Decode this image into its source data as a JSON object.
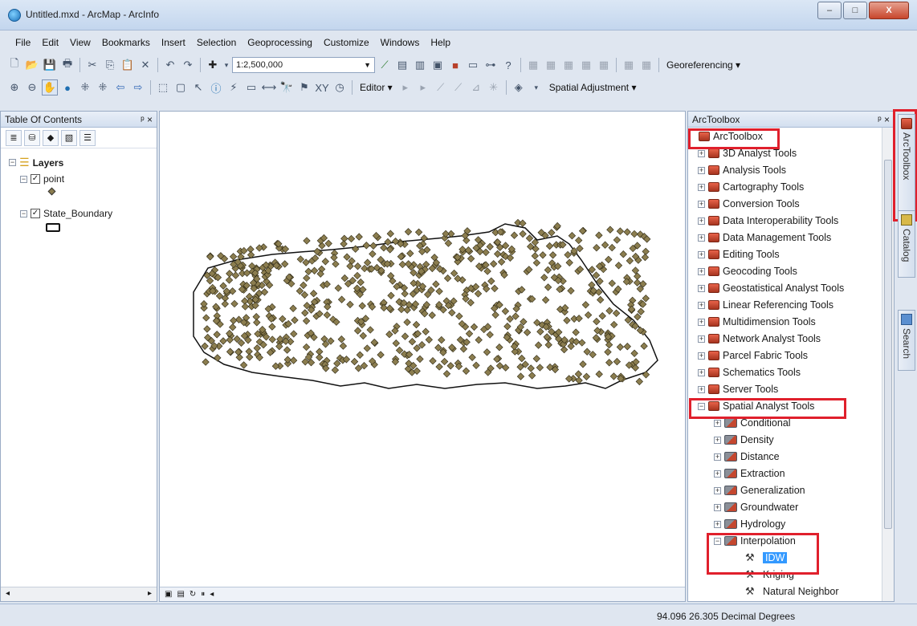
{
  "window": {
    "title": "Untitled.mxd - ArcMap - ArcInfo",
    "min_label": "–",
    "max_label": "□",
    "close_label": "X"
  },
  "menubar": [
    "File",
    "Edit",
    "View",
    "Bookmarks",
    "Insert",
    "Selection",
    "Geoprocessing",
    "Customize",
    "Windows",
    "Help"
  ],
  "toolbar": {
    "scale": "1:2,500,000",
    "georeferencing_label": "Georeferencing ▾",
    "editor_label": "Editor ▾",
    "spatial_adjustment_label": "Spatial Adjustment ▾"
  },
  "toc": {
    "title": "Table Of Contents",
    "pin": "ᵖ ×",
    "layers_label": "Layers",
    "layer_point": "point",
    "layer_state": "State_Boundary"
  },
  "arctoolbox": {
    "title": "ArcToolbox",
    "pin": "ᵖ ×",
    "root": "ArcToolbox",
    "toolboxes": [
      "3D Analyst Tools",
      "Analysis Tools",
      "Cartography Tools",
      "Conversion Tools",
      "Data Interoperability Tools",
      "Data Management Tools",
      "Editing Tools",
      "Geocoding Tools",
      "Geostatistical Analyst Tools",
      "Linear Referencing Tools",
      "Multidimension Tools",
      "Network Analyst Tools",
      "Parcel Fabric Tools",
      "Schematics Tools",
      "Server Tools",
      "Spatial Analyst Tools"
    ],
    "toolsets": [
      "Conditional",
      "Density",
      "Distance",
      "Extraction",
      "Generalization",
      "Groundwater",
      "Hydrology",
      "Interpolation"
    ],
    "tools": [
      "IDW",
      "Kriging",
      "Natural Neighbor"
    ]
  },
  "side_tabs": [
    "ArcToolbox",
    "Catalog",
    "Search"
  ],
  "status": {
    "coords": "94.096  26.305 Decimal Degrees"
  },
  "colors": {
    "highlight": "#e0202c",
    "selection": "#3399ff",
    "point_fill": "#8b7d4f"
  }
}
